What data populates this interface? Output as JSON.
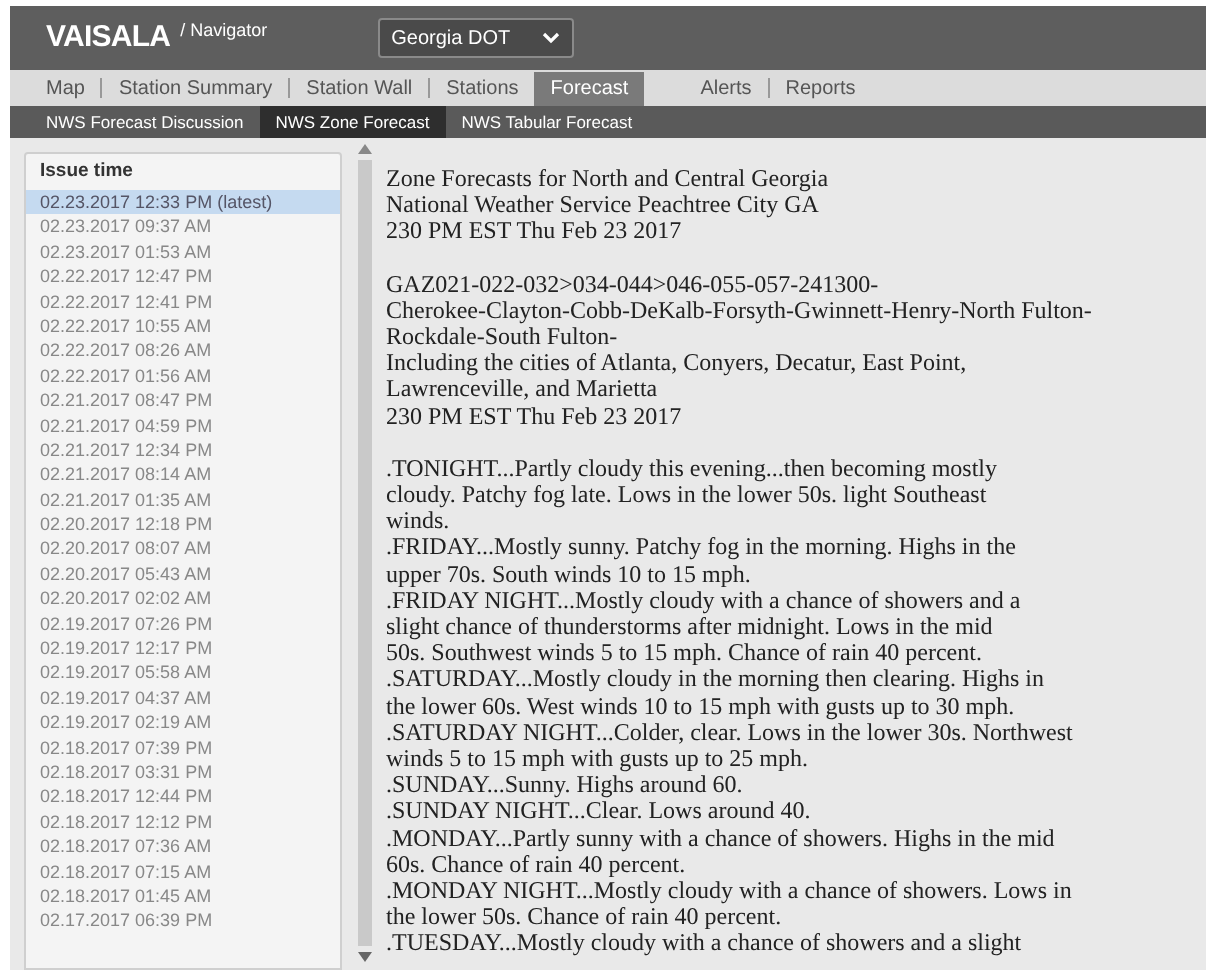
{
  "header": {
    "logo": "VAISALA",
    "product": "/ Navigator",
    "org_select": {
      "value": "Georgia DOT"
    }
  },
  "tabs": [
    {
      "label": "Map",
      "selected": false
    },
    {
      "label": "Station Summary",
      "selected": false
    },
    {
      "label": "Station Wall",
      "selected": false
    },
    {
      "label": "Stations",
      "selected": false
    },
    {
      "label": "Forecast",
      "selected": true
    },
    {
      "label": "Alerts",
      "selected": false
    },
    {
      "label": "Reports",
      "selected": false
    }
  ],
  "subtabs": [
    {
      "label": "NWS Forecast Discussion",
      "selected": false
    },
    {
      "label": "NWS Zone Forecast",
      "selected": true
    },
    {
      "label": "NWS Tabular Forecast",
      "selected": false
    }
  ],
  "issue_list": {
    "heading": "Issue time",
    "items": [
      {
        "label": "02.23.2017 12:33 PM (latest)",
        "selected": true
      },
      {
        "label": "02.23.2017 09:37 AM",
        "selected": false
      },
      {
        "label": "02.23.2017 01:53 AM",
        "selected": false
      },
      {
        "label": "02.22.2017 12:47 PM",
        "selected": false
      },
      {
        "label": "02.22.2017 12:41 PM",
        "selected": false
      },
      {
        "label": "02.22.2017 10:55 AM",
        "selected": false
      },
      {
        "label": "02.22.2017 08:26 AM",
        "selected": false
      },
      {
        "label": "02.22.2017 01:56 AM",
        "selected": false
      },
      {
        "label": "02.21.2017 08:47 PM",
        "selected": false
      },
      {
        "label": "02.21.2017 04:59 PM",
        "selected": false
      },
      {
        "label": "02.21.2017 12:34 PM",
        "selected": false
      },
      {
        "label": "02.21.2017 08:14 AM",
        "selected": false
      },
      {
        "label": "02.21.2017 01:35 AM",
        "selected": false
      },
      {
        "label": "02.20.2017 12:18 PM",
        "selected": false
      },
      {
        "label": "02.20.2017 08:07 AM",
        "selected": false
      },
      {
        "label": "02.20.2017 05:43 AM",
        "selected": false
      },
      {
        "label": "02.20.2017 02:02 AM",
        "selected": false
      },
      {
        "label": "02.19.2017 07:26 PM",
        "selected": false
      },
      {
        "label": "02.19.2017 12:17 PM",
        "selected": false
      },
      {
        "label": "02.19.2017 05:58 AM",
        "selected": false
      },
      {
        "label": "02.19.2017 04:37 AM",
        "selected": false
      },
      {
        "label": "02.19.2017 02:19 AM",
        "selected": false
      },
      {
        "label": "02.18.2017 07:39 PM",
        "selected": false
      },
      {
        "label": "02.18.2017 03:31 PM",
        "selected": false
      },
      {
        "label": "02.18.2017 12:44 PM",
        "selected": false
      },
      {
        "label": "02.18.2017 12:12 PM",
        "selected": false
      },
      {
        "label": "02.18.2017 07:36 AM",
        "selected": false
      },
      {
        "label": "02.18.2017 07:15 AM",
        "selected": false
      },
      {
        "label": "02.18.2017 01:45 AM",
        "selected": false
      },
      {
        "label": "02.17.2017 06:39 PM",
        "selected": false
      }
    ]
  },
  "forecast": {
    "blocks": [
      {
        "lines": [
          "Zone Forecasts for North and Central Georgia",
          "National Weather Service Peachtree City GA",
          "230 PM EST Thu Feb 23 2017"
        ]
      },
      {
        "lines": [
          "GAZ021-022-032>034-044>046-055-057-241300-",
          "Cherokee-Clayton-Cobb-DeKalb-Forsyth-Gwinnett-Henry-North Fulton-",
          "Rockdale-South Fulton-",
          "Including the cities of Atlanta, Conyers, Decatur, East Point,",
          "Lawrenceville, and Marietta",
          "230 PM EST Thu Feb 23 2017"
        ]
      },
      {
        "lines": [
          ".TONIGHT...Partly cloudy this evening...then becoming mostly",
          "cloudy. Patchy fog late. Lows in the lower 50s. light Southeast",
          "winds.",
          ".FRIDAY...Mostly sunny. Patchy fog in the morning. Highs in the",
          "upper 70s. South winds 10 to 15 mph.",
          ".FRIDAY NIGHT...Mostly cloudy with a chance of showers and a",
          "slight chance of thunderstorms after midnight. Lows in the mid",
          "50s. Southwest winds 5 to 15 mph. Chance of rain 40 percent.",
          ".SATURDAY...Mostly cloudy in the morning then clearing. Highs in",
          "the lower 60s. West winds 10 to 15 mph with gusts up to 30 mph.",
          ".SATURDAY NIGHT...Colder, clear. Lows in the lower 30s. Northwest",
          "winds 5 to 15 mph with gusts up to 25 mph.",
          ".SUNDAY...Sunny. Highs around 60.",
          ".SUNDAY NIGHT...Clear. Lows around 40.",
          ".MONDAY...Partly sunny with a chance of showers. Highs in the mid",
          "60s. Chance of rain 40 percent.",
          ".MONDAY NIGHT...Mostly cloudy with a chance of showers. Lows in",
          "the lower 50s. Chance of rain 40 percent.",
          ".TUESDAY...Mostly cloudy with a chance of showers and a slight"
        ]
      }
    ]
  }
}
